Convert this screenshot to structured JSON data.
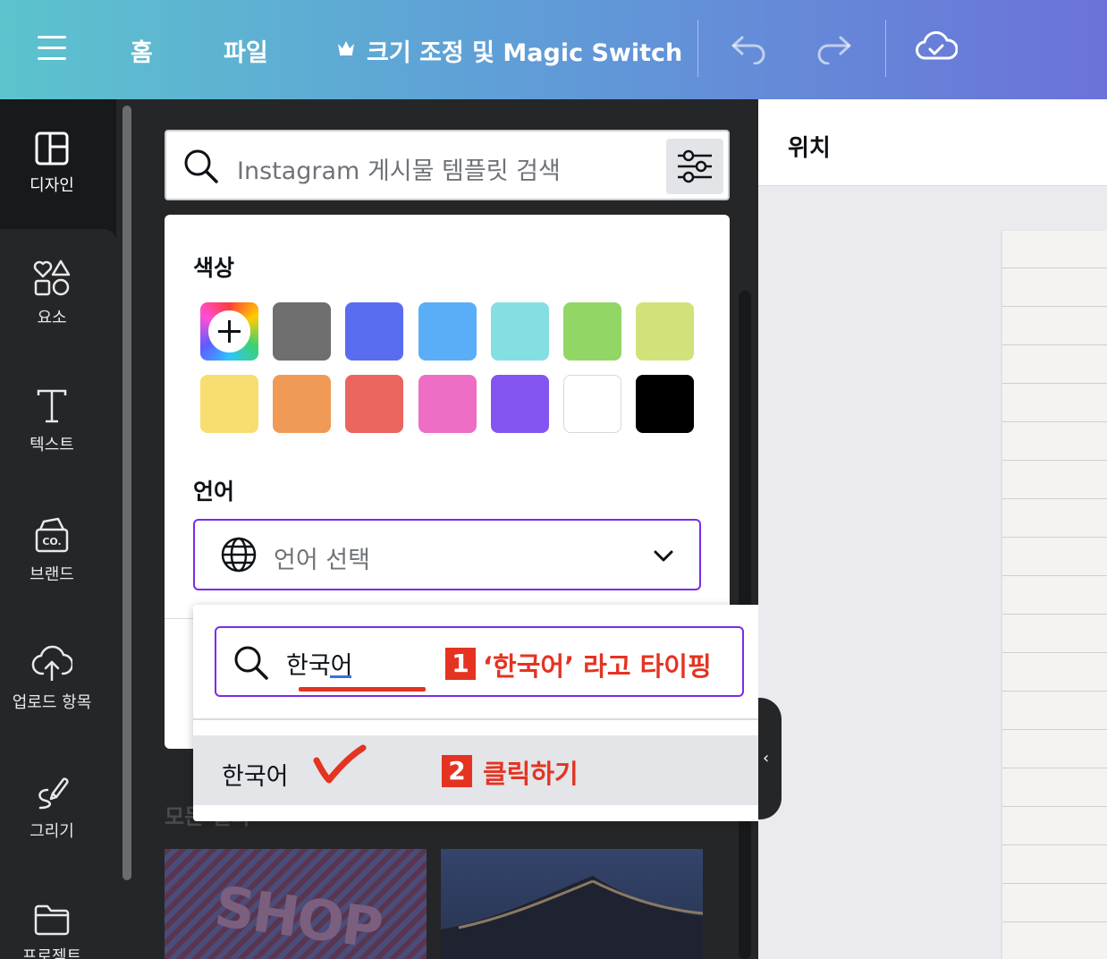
{
  "topbar": {
    "home": "홈",
    "file": "파일",
    "resize": "크기 조정 및 Magic Switch"
  },
  "rail": [
    {
      "label": "디자인",
      "icon": "layout-icon"
    },
    {
      "label": "요소",
      "icon": "shapes-icon"
    },
    {
      "label": "텍스트",
      "icon": "text-icon"
    },
    {
      "label": "브랜드",
      "icon": "brand-icon"
    },
    {
      "label": "업로드 항목",
      "icon": "upload-icon"
    },
    {
      "label": "그리기",
      "icon": "draw-icon"
    },
    {
      "label": "프로젝트",
      "icon": "folder-icon"
    }
  ],
  "search": {
    "placeholder": "Instagram 게시물 템플릿 검색"
  },
  "filters": {
    "color_title": "색상",
    "colors": [
      "#6f6f6f",
      "#5a6cf0",
      "#5aaef7",
      "#84dfe3",
      "#92d766",
      "#d3e17a",
      "#f8dd70",
      "#f09a58",
      "#ea655e",
      "#ee6ec5",
      "#8455f0",
      "#ffffff",
      "#000000"
    ],
    "language_title": "언어",
    "language_placeholder": "언어 선택"
  },
  "dropdown": {
    "search_value": "한국어",
    "option": "한국어"
  },
  "annotations": {
    "step1_num": "1",
    "step1_text": "‘한국어’ 라고 타이핑",
    "step2_num": "2",
    "step2_text": "클릭하기"
  },
  "results": {
    "all_label": "모든 결과",
    "thumb1_text": "SHOP"
  },
  "right": {
    "title": "위치"
  }
}
